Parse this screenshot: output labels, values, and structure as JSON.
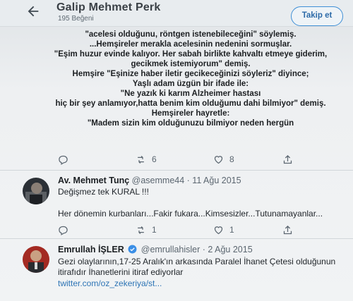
{
  "header": {
    "title": "Galip Mehmet Perk",
    "likes": "195 Beğeni",
    "follow_label": "Takip et"
  },
  "main_post": {
    "lines_a": [
      "\"acelesi olduğunu, röntgen istenebileceğini\" söylemiş.",
      "...Hemşireler merakla acelesinin nedenini sormuşlar.",
      "\"Eşim huzur evinde kalıyor. Her sabah birlikte kahvaltı etmeye giderim,",
      "gecikmek istemiyorum\" demiş.",
      "Hemşire \"Eşinize haber iletir gecikeceğinizi söyleriz\" diyince;"
    ],
    "lines_b": [
      "Yaşlı adam üzgün bir ifade ile:",
      "\"Ne yazık ki karım Alzheimer hastası",
      "hiç bir şey anlamıyor,hatta benim kim olduğumu dahi bilmiyor\" demiş.",
      "Hemşireler hayretle:",
      "\"Madem sizin kim olduğunuzu bilmiyor neden hergün"
    ],
    "actions": {
      "reply": "",
      "retweet": "6",
      "like": "8",
      "share": ""
    }
  },
  "tweets": [
    {
      "name": "Av. Mehmet Tunç",
      "handle_date": "@asemme44 · 11 Ağu 2015",
      "line1": "Değişmez tek KURAL !!!",
      "line2": "Her dönemin kurbanları...Fakir fukara...Kimsesizler...Tutunamayanlar...",
      "actions": {
        "reply": "",
        "retweet": "1",
        "like": "1",
        "share": ""
      }
    },
    {
      "name": "Emrullah İŞLER",
      "handle_date": "@emrullahisler · 2 Ağu 2015",
      "line1": "Gezi olaylarının,17-25 Aralık'ın arkasında Paralel İhanet Çetesi olduğunun",
      "line2": "itirafıdır İhanetlerini itiraf ediyorlar",
      "link": "twitter.com/oz_zekeriya/st..."
    }
  ],
  "colors": {
    "accent": "#2d74b5",
    "verified": "#3a8ee6"
  }
}
